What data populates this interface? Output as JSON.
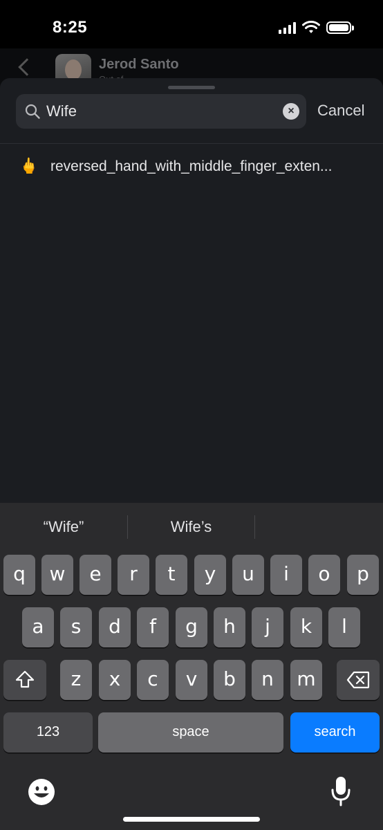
{
  "status": {
    "time": "8:25",
    "signal_icon": "cellular-signal-icon",
    "wifi_icon": "wifi-icon",
    "battery_icon": "battery-icon"
  },
  "background_chat": {
    "contact_name": "Jerod Santo",
    "subtitle": "Out of"
  },
  "emoji_search": {
    "search_value": "Wife",
    "cancel_label": "Cancel",
    "results": [
      {
        "emoji": "🖕",
        "name": "reversed_hand_with_middle_finger_exten..."
      }
    ]
  },
  "keyboard": {
    "suggestions": [
      "“Wife”",
      "Wife’s",
      ""
    ],
    "row1": [
      "q",
      "w",
      "e",
      "r",
      "t",
      "y",
      "u",
      "i",
      "o",
      "p"
    ],
    "row2": [
      "a",
      "s",
      "d",
      "f",
      "g",
      "h",
      "j",
      "k",
      "l"
    ],
    "row3": [
      "z",
      "x",
      "c",
      "v",
      "b",
      "n",
      "m"
    ],
    "numbers_label": "123",
    "space_label": "space",
    "search_label": "search",
    "accent_color": "#0a7cff"
  }
}
